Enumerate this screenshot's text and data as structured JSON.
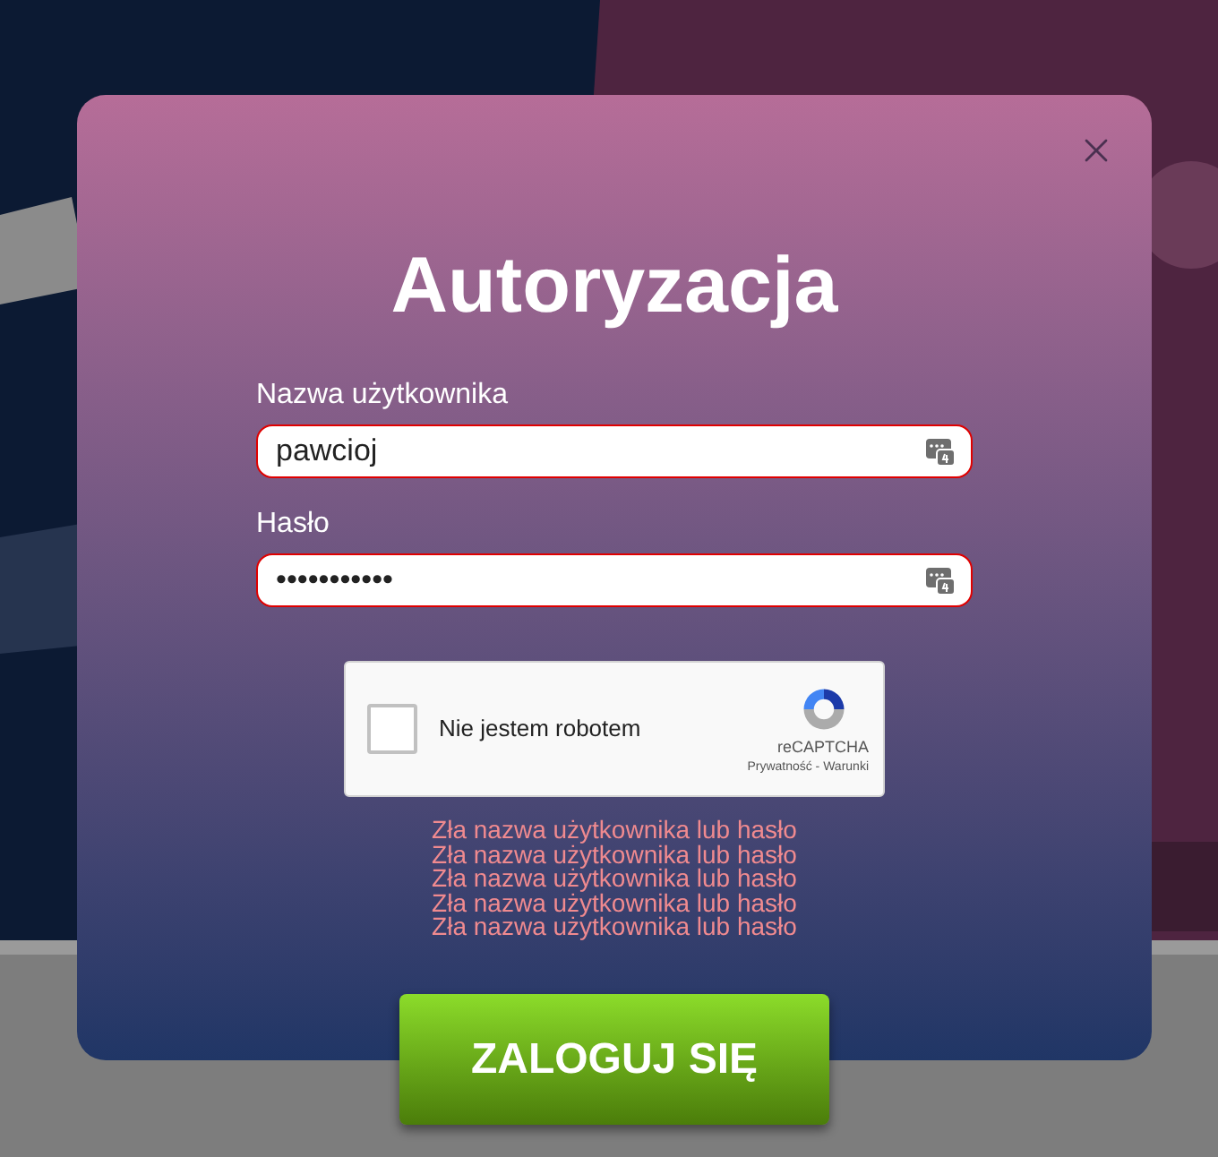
{
  "dialog": {
    "title": "Autoryzacja",
    "fields": [
      {
        "label": "Nazwa użytkownika",
        "value": "pawcioj",
        "invalid": true
      },
      {
        "label": "Hasło",
        "value": "•••••••••••",
        "invalid": true
      }
    ],
    "captcha": {
      "label": "Nie jestem robotem",
      "checked": false,
      "brand": "reCAPTCHA",
      "links": "Prywatność - Warunki"
    },
    "errors": [
      "Zła nazwa użytkownika lub hasło",
      "Zła nazwa użytkownika lub hasło",
      "Zła nazwa użytkownika lub hasło",
      "Zła nazwa użytkownika lub hasło",
      "Zła nazwa użytkownika lub hasło"
    ],
    "submit": "ZALOGUJ SIĘ"
  }
}
